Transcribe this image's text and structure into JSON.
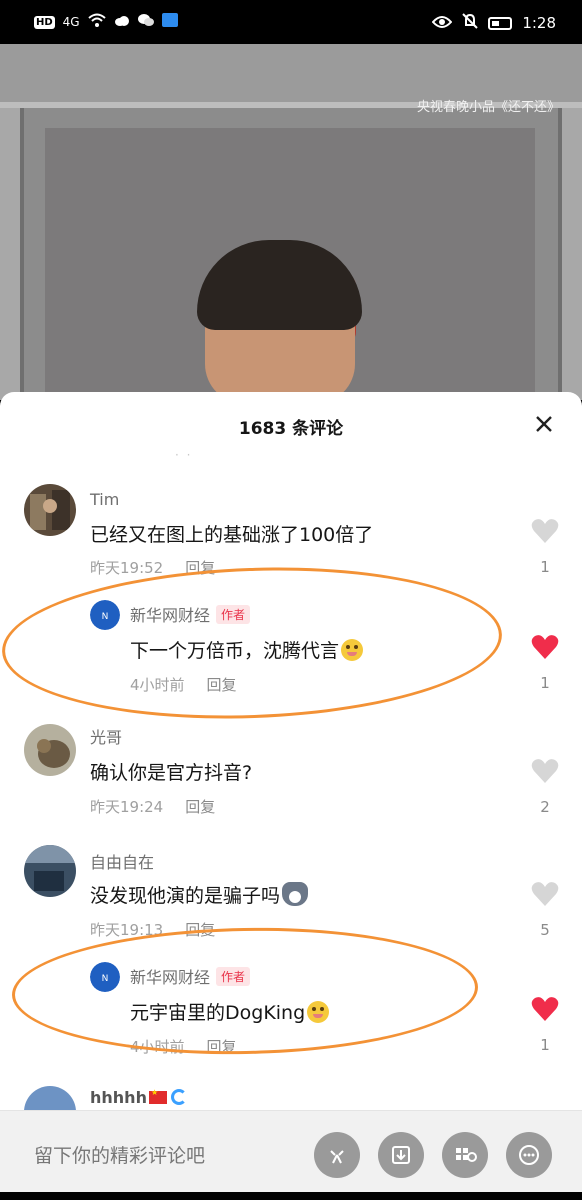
{
  "status_bar": {
    "left_icons": [
      "hd-icon",
      "signal-4g-icon",
      "wifi-icon",
      "cloud-icon",
      "wechat-icon",
      "app-icon"
    ],
    "network": "4G",
    "hd": "HD",
    "time": "1:28"
  },
  "video": {
    "caption": "央视春晚小品《还不还》"
  },
  "comments_panel": {
    "title": "1683 条评论",
    "faded_text": "·  ·",
    "comments": [
      {
        "user": "Tim",
        "text": "已经又在图上的基础涨了100倍了",
        "time": "昨天19:52",
        "reply_label": "回复",
        "likes": "1",
        "liked": false,
        "reply": {
          "user": "新华网财经",
          "badge": "作者",
          "text": "下一个万倍币，沈腾代言",
          "time": "4小时前",
          "reply_label": "回复",
          "likes": "1",
          "liked": true
        }
      },
      {
        "user": "光哥",
        "text": "确认你是官方抖音?",
        "time": "昨天19:24",
        "reply_label": "回复",
        "likes": "2",
        "liked": false
      },
      {
        "user": "自由自在",
        "text": "没发现他演的是骗子吗",
        "time": "昨天19:13",
        "reply_label": "回复",
        "likes": "5",
        "liked": false,
        "reply": {
          "user": "新华网财经",
          "badge": "作者",
          "text": "元宇宙里的DogKing",
          "time": "4小时前",
          "reply_label": "回复",
          "likes": "1",
          "liked": true
        }
      },
      {
        "user": "hhhhh"
      }
    ]
  },
  "input_bar": {
    "placeholder": "留下你的精彩评论吧",
    "buttons": [
      "emoji-icon",
      "download-icon",
      "grid-icon",
      "mention-icon"
    ]
  },
  "colors": {
    "like_active": "#f02d4b",
    "like_inactive": "#d6d6d6",
    "annotation": "#f39236",
    "author_tag_bg": "#fde4e6",
    "author_tag_text": "#e9334a"
  }
}
